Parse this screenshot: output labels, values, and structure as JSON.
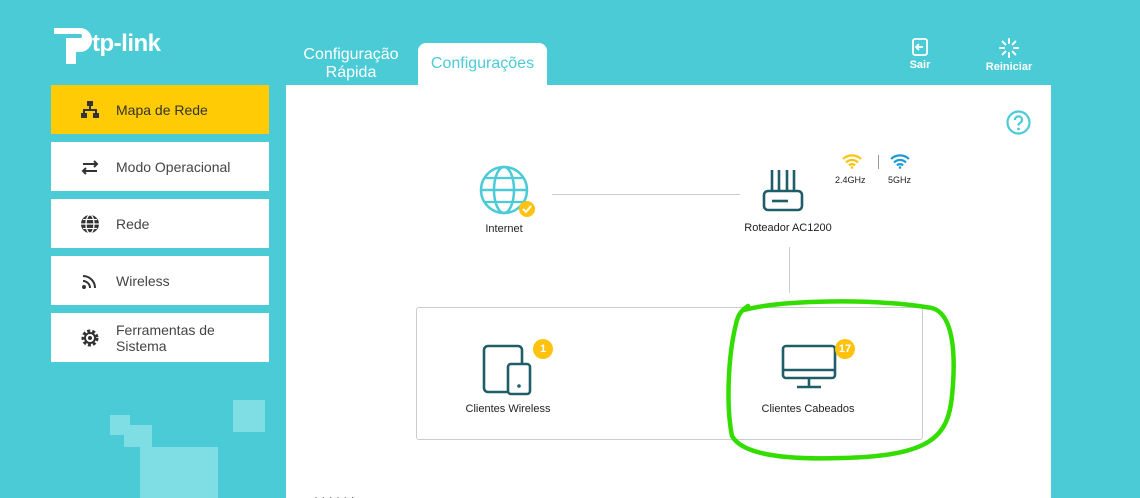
{
  "brand": {
    "name": "tp-link"
  },
  "tabs": [
    {
      "label": "Configuração Rápida"
    },
    {
      "label": "Configurações",
      "active": true
    }
  ],
  "top_actions": {
    "exit_label": "Sair",
    "reboot_label": "Reiniciar"
  },
  "sidebar": {
    "items": [
      {
        "label": "Mapa de Rede",
        "icon": "network-map-icon",
        "active": true
      },
      {
        "label": "Modo Operacional",
        "icon": "operation-mode-icon"
      },
      {
        "label": "Rede",
        "icon": "globe-icon"
      },
      {
        "label": "Wireless",
        "icon": "wireless-icon"
      },
      {
        "label": "Ferramentas de Sistema",
        "icon": "gear-icon"
      }
    ]
  },
  "network_map": {
    "internet_label": "Internet",
    "router_label": "Roteador AC1200",
    "band_24_label": "2.4GHz",
    "band_5_label": "5GHz",
    "wireless_clients_label": "Clientes Wireless",
    "wireless_clients_count": "1",
    "wired_clients_label": "Clientes Cabeados",
    "wired_clients_count": "17"
  },
  "colors": {
    "background": "#4acbd6",
    "accent_yellow": "#ffcb05",
    "icon_dark": "#1f5d69",
    "badge": "#ffc20e",
    "highlight_green": "#33dd00"
  }
}
